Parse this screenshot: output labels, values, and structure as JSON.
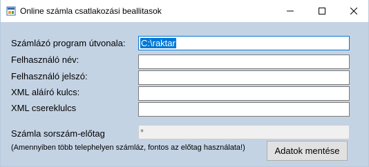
{
  "window": {
    "title": "Online számla csatlakozási beallitasok",
    "controls": {
      "minimize_icon": "minimize-icon",
      "maximize_icon": "maximize-icon",
      "close_icon": "close-icon"
    }
  },
  "form": {
    "fields": [
      {
        "label": "Számlázó program útvonala:",
        "value": "C:\\raktar",
        "selected": true
      },
      {
        "label": "Felhasználó név:",
        "value": ""
      },
      {
        "label": "Felhasználó jelszó:",
        "value": ""
      },
      {
        "label": "XML aláíró kulcs:",
        "value": ""
      },
      {
        "label": "XML csereklulcs",
        "value": ""
      }
    ],
    "prefix": {
      "label": "Számla sorszám-előtag",
      "value": "*",
      "disabled": true
    },
    "note": "(Amennyiben több telephelyen számláz, fontos az előtag használata!)",
    "save_button": "Adatok mentése"
  },
  "colors": {
    "client_background": "#c4d3e4",
    "selection": "#0078d7"
  }
}
